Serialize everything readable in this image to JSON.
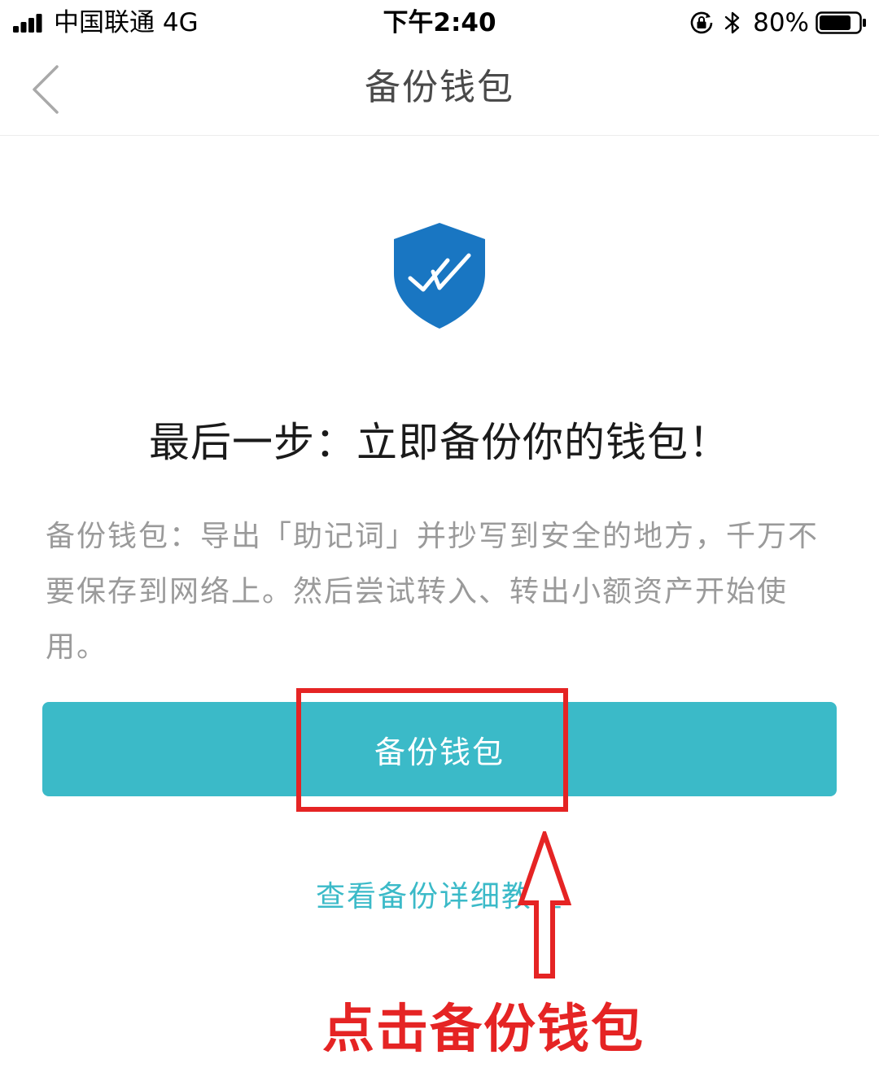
{
  "status_bar": {
    "carrier": "中国联通   4G",
    "time": "下午2:40",
    "battery": "80%",
    "icons": [
      "signal-icon",
      "rotation-lock-icon",
      "bluetooth-icon",
      "battery-icon"
    ]
  },
  "nav": {
    "title": "备份钱包",
    "back_icon": "chevron-left-icon"
  },
  "content": {
    "shield_icon": "shield-check-icon",
    "headline": "最后一步：立即备份你的钱包！",
    "description": "备份钱包：导出「助记词」并抄写到安全的地方，千万不要保存到网络上。然后尝试转入、转出小额资产开始使用。",
    "button_label": "备份钱包",
    "tutorial_link": "查看备份详细教程"
  },
  "annotation": {
    "label": "点击备份钱包",
    "arrow_icon": "arrow-up-icon"
  },
  "colors": {
    "accent": "#3bbac8",
    "shield": "#1976c2",
    "annotation": "#e52424",
    "text_primary": "#1a1a1a",
    "text_secondary": "#9a9a9a"
  }
}
